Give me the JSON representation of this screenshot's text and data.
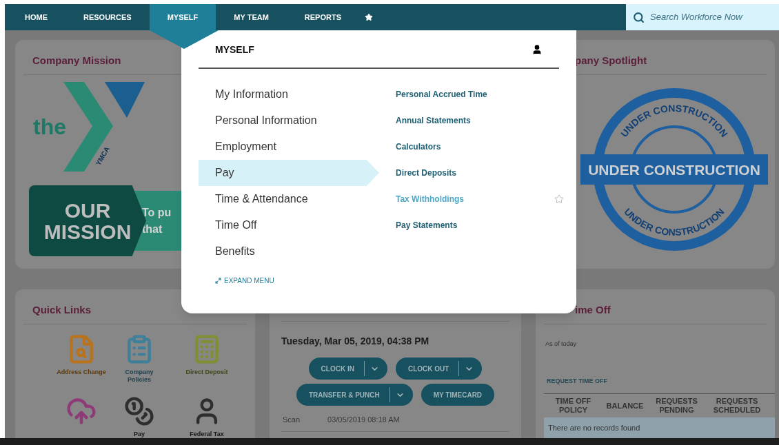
{
  "nav": {
    "items": [
      {
        "label": "HOME",
        "selected": false
      },
      {
        "label": "RESOURCES",
        "selected": false
      },
      {
        "label": "MYSELF",
        "selected": true
      },
      {
        "label": "MY TEAM",
        "selected": false
      },
      {
        "label": "REPORTS",
        "selected": false
      }
    ],
    "search": {
      "placeholder": "Search Workforce Now"
    }
  },
  "mission": {
    "title": "Company Mission",
    "logo_word": "the",
    "logo_mark": "YMCA",
    "badge": "OUR MISSION",
    "band_lines": [
      "To pu",
      "that"
    ]
  },
  "spotlight": {
    "title": "pany Spotlight",
    "stamp": {
      "top": "UNDER CONSTRUCTION",
      "banner": "UNDER CONSTRUCTION",
      "bottom": "UNDER CONSTRUCTION"
    }
  },
  "quick_links": {
    "title": "Quick Links",
    "links": [
      {
        "kind": "document",
        "label": "Address Change",
        "color": "#b8731c"
      },
      {
        "kind": "clipboard",
        "label": "Company Policies",
        "color": "#3f7f99"
      },
      {
        "kind": "calculator",
        "label": "Direct Deposit",
        "color": "#7f8f33"
      },
      {
        "kind": "cloud",
        "color": "#8e3a78"
      },
      {
        "kind": "coins",
        "label": "Pay",
        "color": "#2e2e2e"
      },
      {
        "kind": "person",
        "label": "Federal Tax",
        "color": "#2e2e2e"
      }
    ]
  },
  "timecard": {
    "datetime": "Tuesday, Mar 05, 2019, 04:38 PM",
    "buttons": [
      {
        "label": "CLOCK IN",
        "dropdown": true
      },
      {
        "label": "CLOCK OUT",
        "dropdown": true
      },
      {
        "label": "TRANSFER & PUNCH",
        "dropdown": true
      },
      {
        "label": "MY TIMECARD",
        "dropdown": false
      }
    ],
    "scan_label": "Scan",
    "scan_value": "03/05/2019 08:18 AM"
  },
  "time_off": {
    "title": "ime Off",
    "as_of": "As of today",
    "request_link": "REQUEST TIME OFF",
    "columns": [
      "TIME OFF POLICY",
      "BALANCE",
      "REQUESTS PENDING",
      "REQUESTS SCHEDULED"
    ],
    "empty": "There are no records found"
  },
  "menu": {
    "title": "MYSELF",
    "left_items": [
      {
        "label": "My Information",
        "selected": false
      },
      {
        "label": "Personal Information",
        "selected": false
      },
      {
        "label": "Employment",
        "selected": false
      },
      {
        "label": "Pay",
        "selected": true
      },
      {
        "label": "Time & Attendance",
        "selected": false
      },
      {
        "label": "Time Off",
        "selected": false
      },
      {
        "label": "Benefits",
        "selected": false
      }
    ],
    "right_items": [
      {
        "label": "Personal Accrued Time",
        "hovered": false
      },
      {
        "label": "Annual Statements",
        "hovered": false
      },
      {
        "label": "Calculators",
        "hovered": false
      },
      {
        "label": "Direct Deposits",
        "hovered": false
      },
      {
        "label": "Tax Withholdings",
        "hovered": true
      },
      {
        "label": "Pay Statements",
        "hovered": false
      }
    ],
    "expand": "EXPAND MENU"
  }
}
